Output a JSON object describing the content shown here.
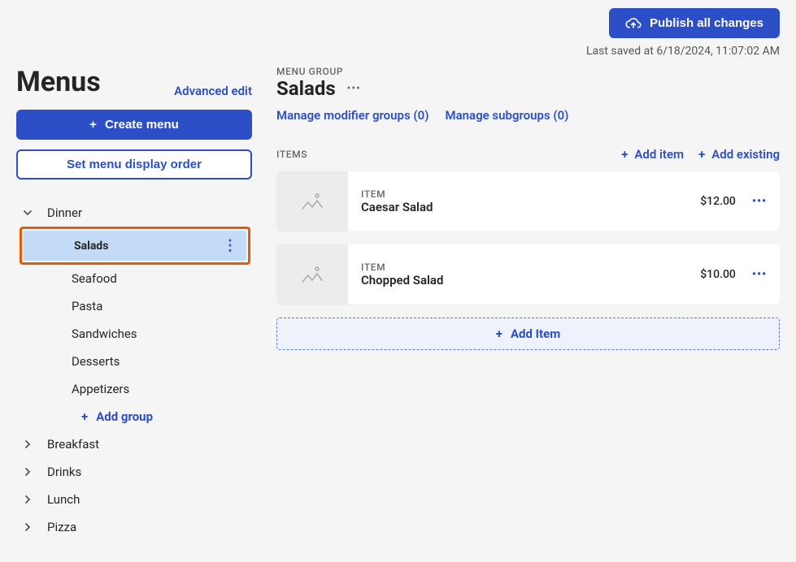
{
  "topbar": {
    "publish_label": "Publish all changes",
    "last_saved": "Last saved at 6/18/2024, 11:07:02 AM"
  },
  "sidebar": {
    "title": "Menus",
    "advanced_edit": "Advanced edit",
    "create_menu": "Create menu",
    "display_order": "Set menu display order",
    "menus": [
      {
        "label": "Dinner",
        "expanded": true,
        "groups": [
          {
            "label": "Salads",
            "selected": true
          },
          {
            "label": "Seafood"
          },
          {
            "label": "Pasta"
          },
          {
            "label": "Sandwiches"
          },
          {
            "label": "Desserts"
          },
          {
            "label": "Appetizers"
          }
        ],
        "add_group_label": "Add group"
      },
      {
        "label": "Breakfast",
        "expanded": false
      },
      {
        "label": "Drinks",
        "expanded": false
      },
      {
        "label": "Lunch",
        "expanded": false
      },
      {
        "label": "Pizza",
        "expanded": false
      }
    ]
  },
  "main": {
    "meta": "MENU GROUP",
    "heading": "Salads",
    "modifier_link": "Manage modifier groups (0)",
    "subgroup_link": "Manage subgroups (0)",
    "items_label": "ITEMS",
    "add_item_link": "Add item",
    "add_existing_link": "Add existing",
    "item_meta": "ITEM",
    "items": [
      {
        "name": "Caesar Salad",
        "price": "$12.00"
      },
      {
        "name": "Chopped Salad",
        "price": "$10.00"
      }
    ],
    "add_item_button": "Add Item"
  }
}
